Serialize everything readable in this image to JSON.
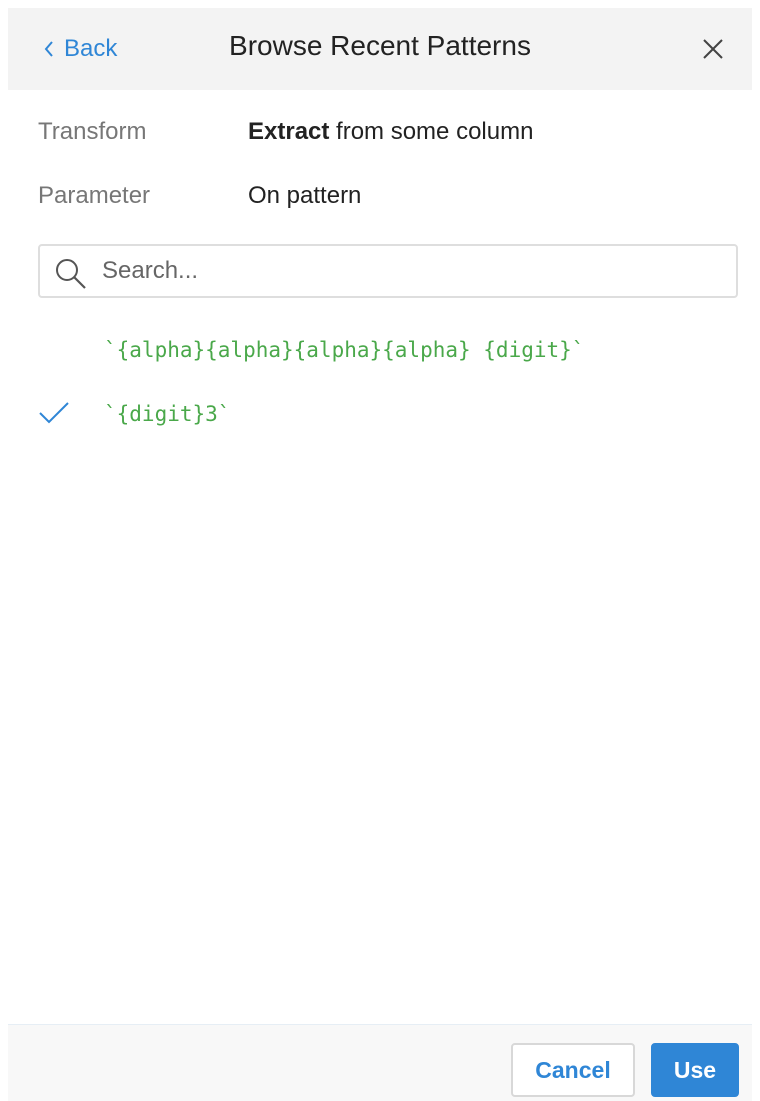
{
  "header": {
    "back_label": "Back",
    "title": "Browse Recent Patterns"
  },
  "details": {
    "transform_label": "Transform",
    "transform_value_bold": "Extract",
    "transform_value_rest": " from some column",
    "parameter_label": "Parameter",
    "parameter_value": "On pattern"
  },
  "search": {
    "placeholder": "Search..."
  },
  "patterns": [
    {
      "text": "`{alpha}{alpha}{alpha}{alpha} {digit}`",
      "selected": false
    },
    {
      "text": "`{digit}3`",
      "selected": true
    }
  ],
  "footer": {
    "cancel_label": "Cancel",
    "use_label": "Use"
  },
  "colors": {
    "accent": "#2f86d6",
    "pattern_text": "#4aa84a"
  }
}
